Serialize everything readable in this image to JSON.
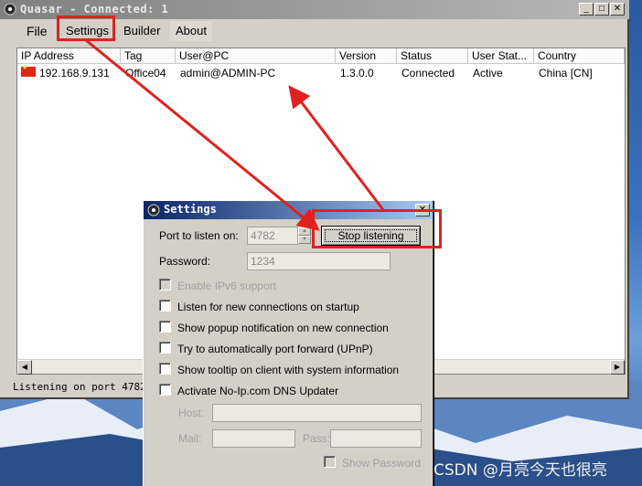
{
  "window": {
    "title": "Quasar - Connected: 1",
    "minimize_glyph": "_",
    "maximize_glyph": "□",
    "close_glyph": "✕"
  },
  "menu": {
    "items": [
      {
        "label": "File"
      },
      {
        "label": "Settings"
      },
      {
        "label": "Builder"
      },
      {
        "label": "About"
      }
    ]
  },
  "clients_table": {
    "columns": [
      "IP Address",
      "Tag",
      "User@PC",
      "Version",
      "Status",
      "User Stat...",
      "Country"
    ],
    "rows": [
      {
        "ip": "192.168.9.131",
        "tag": "Office04",
        "user_pc": "admin@ADMIN-PC",
        "version": "1.3.0.0",
        "status": "Connected",
        "user_status": "Active",
        "country": "China [CN]"
      }
    ]
  },
  "statusbar": {
    "text": "Listening on port 4782."
  },
  "settings_dialog": {
    "title": "Settings",
    "close_glyph": "✕",
    "port_label": "Port to listen on:",
    "port_value": "4782",
    "stop_button": "Stop listening",
    "password_label": "Password:",
    "password_value": "1234",
    "options": [
      {
        "label": "Enable IPv6 support",
        "enabled": false,
        "checked": false
      },
      {
        "label": "Listen for new connections on startup",
        "enabled": true,
        "checked": false
      },
      {
        "label": "Show popup notification on new connection",
        "enabled": true,
        "checked": false
      },
      {
        "label": "Try to automatically port forward (UPnP)",
        "enabled": true,
        "checked": false
      },
      {
        "label": "Show tooltip on client with system information",
        "enabled": true,
        "checked": false
      },
      {
        "label": "Activate No-Ip.com DNS Updater",
        "enabled": true,
        "checked": false
      }
    ],
    "host_label": "Host:",
    "mail_label": "Mail:",
    "pass_label": "Pass:",
    "show_password_label": "Show Password"
  },
  "watermark": "CSDN @月亮今天也很亮",
  "colors": {
    "annotation": "#e0211f",
    "dialog_title_start": "#0a246a",
    "dialog_title_end": "#a6caf0"
  }
}
